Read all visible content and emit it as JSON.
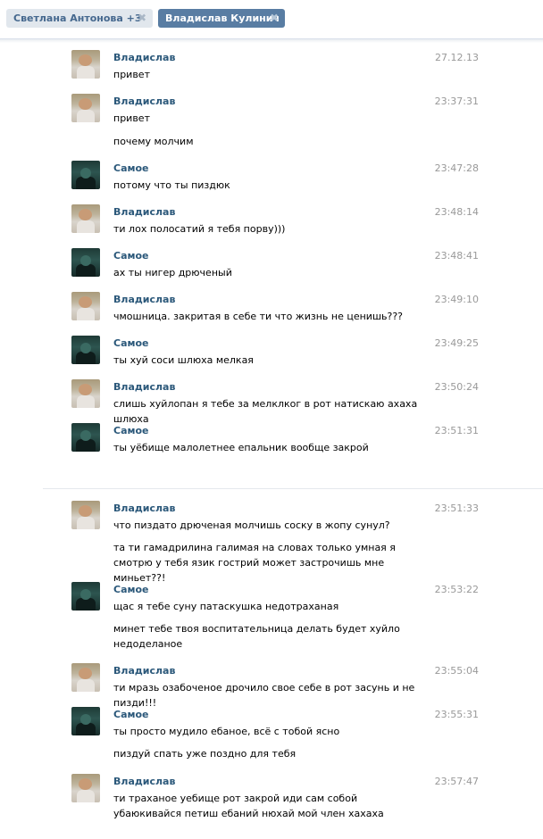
{
  "tabs": [
    {
      "label": "Светлана Антонова +3",
      "close": "✖"
    },
    {
      "label": "Владислав Кулинич",
      "close": "✖"
    }
  ],
  "messages": [
    {
      "author": "Владислав",
      "avatar": "vladislav",
      "time": "27.12.13",
      "lines": [
        "привет"
      ]
    },
    {
      "author": "Владислав",
      "avatar": "vladislav",
      "time": "23:37:31",
      "lines": [
        "привет",
        "почему молчим"
      ]
    },
    {
      "author": "Самое",
      "avatar": "samoe",
      "time": "23:47:28",
      "lines": [
        "потому что ты пиздюк"
      ]
    },
    {
      "author": "Владислав",
      "avatar": "vladislav",
      "time": "23:48:14",
      "lines": [
        "ти лох полосатий я тебя порву)))"
      ]
    },
    {
      "author": "Самое",
      "avatar": "samoe",
      "time": "23:48:41",
      "lines": [
        "ах ты нигер дрюченый"
      ]
    },
    {
      "author": "Владислав",
      "avatar": "vladislav",
      "time": "23:49:10",
      "lines": [
        "чмошница. закритая в себе ти что жизнь не ценишь???"
      ]
    },
    {
      "author": "Самое",
      "avatar": "samoe",
      "time": "23:49:25",
      "lines": [
        "ты хуй соси шлюха мелкая"
      ]
    },
    {
      "author": "Владислав",
      "avatar": "vladislav",
      "time": "23:50:24",
      "lines": [
        "слишь хуйлопан я тебе за мелклког в рот натискаю ахаха шлюха"
      ]
    },
    {
      "author": "Самое",
      "avatar": "samoe",
      "time": "23:51:31",
      "lines": [
        "ты уёбище малолетнее епальник вообще закрой"
      ]
    },
    {
      "author": "Владислав",
      "avatar": "vladislav",
      "time": "23:51:33",
      "lines": [
        "что пиздато дрюченая молчишь соску в жопу сунул?",
        "та ти гамадрилина галимая на словах только умная я смотрю у тебя язик гострий может застрочишь мне миньет??!"
      ]
    },
    {
      "author": "Самое",
      "avatar": "samoe",
      "time": "23:53:22",
      "lines": [
        "щас я тебе суну патаскушка недотраханая",
        "минет тебе твоя воспитательница делать будет хуйло недоделаное"
      ]
    },
    {
      "author": "Владислав",
      "avatar": "vladislav",
      "time": "23:55:04",
      "lines": [
        "ти мразь озабоченое дрочило свое себе в рот засунь и не пизди!!!"
      ]
    },
    {
      "author": "Самое",
      "avatar": "samoe",
      "time": "23:55:31",
      "lines": [
        "ты просто мудило ебаное, всё с тобой ясно",
        "пиздуй спать уже поздно для тебя"
      ]
    },
    {
      "author": "Владислав",
      "avatar": "vladislav",
      "time": "23:57:47",
      "lines": [
        "ти траханое уебище рот закрой иди сам собой убаюкивайся петиш ебаний нюхай мой член хахаха"
      ]
    }
  ]
}
